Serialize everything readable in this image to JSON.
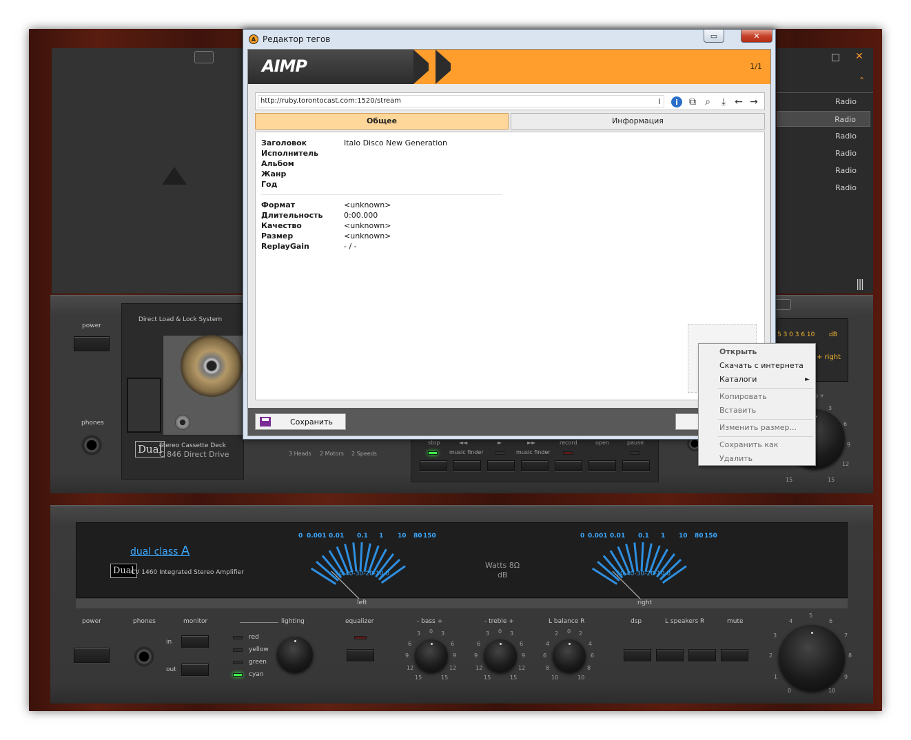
{
  "dialog": {
    "title": "Редактор тегов",
    "brand": "AIMP",
    "counter": "1/1",
    "url": "http://ruby.torontocast.com:1520/stream",
    "tabs": [
      {
        "label": "Общее"
      },
      {
        "label": "Информация"
      }
    ],
    "fields_main": [
      {
        "label": "Заголовок",
        "value": "Italo Disco New Generation"
      },
      {
        "label": "Исполнитель",
        "value": ""
      },
      {
        "label": "Альбом",
        "value": ""
      },
      {
        "label": "Жанр",
        "value": ""
      },
      {
        "label": "Год",
        "value": ""
      }
    ],
    "fields_info": [
      {
        "label": "Формат",
        "value": "<unknown>"
      },
      {
        "label": "Длительность",
        "value": "0:00.000"
      },
      {
        "label": "Качество",
        "value": "<unknown>"
      },
      {
        "label": "Размер",
        "value": "<unknown>"
      },
      {
        "label": "ReplayGain",
        "value": "- / -"
      }
    ],
    "save_label": "Сохранить"
  },
  "context_menu": {
    "items": [
      {
        "label": "Открыть",
        "state": "default"
      },
      {
        "label": "Скачать с интернета",
        "state": "enabled"
      },
      {
        "label": "Каталоги",
        "state": "submenu"
      },
      {
        "label": "Копировать",
        "state": "disabled"
      },
      {
        "label": "Вставить",
        "state": "disabled"
      },
      {
        "label": "Изменить размер...",
        "state": "disabled"
      },
      {
        "label": "Сохранить как",
        "state": "disabled"
      },
      {
        "label": "Удалить",
        "state": "disabled"
      }
    ]
  },
  "playlist": {
    "items": [
      "Radio",
      "Radio",
      "Radio",
      "Radio",
      "Radio",
      "Radio"
    ],
    "selected_index": 1
  },
  "deck": {
    "power_label": "power",
    "phones_label": "phones",
    "system_label": "Direct Load & Lock System",
    "brand": "Dual",
    "model_line1": "Stereo Cassette Deck",
    "model_line2": "C 846 Direct Drive",
    "features": [
      "3 Heads",
      "2 Motors",
      "2 Speeds"
    ],
    "transport_labels": [
      "stop",
      "◄◄",
      "►",
      "►►",
      "record",
      "open",
      "pause"
    ],
    "music_finder": "music finder",
    "vu_scale": "5 3 0 3 6 10",
    "vu_unit": "dB",
    "vu_right": "right",
    "rec_level_label": "p +",
    "level_scale": [
      "3",
      "6",
      "9",
      "12",
      "15",
      "15"
    ]
  },
  "amp": {
    "brand_line": "dual class",
    "brand_letter": "A",
    "brand": "Dual",
    "model": "CV 1460 Integrated Stereo Amplifier",
    "meter_scale": [
      "0",
      "0.001",
      "0.01",
      "0.1",
      "1",
      "10",
      "80",
      "150"
    ],
    "meter_db": "-50-40-30-20-10  0",
    "watts": "Watts 8Ω",
    "db": "dB",
    "left": "left",
    "right": "right",
    "power_label": "power",
    "phones_label": "phones",
    "monitor_label": "monitor",
    "monitor_in": "in",
    "monitor_out": "out",
    "lighting_label": "lighting",
    "lighting_options": [
      "red",
      "yellow",
      "green",
      "cyan"
    ],
    "equalizer_label": "equalizer",
    "bass_label": "-  bass  +",
    "treble_label": "-  treble  +",
    "balance_label": "L  balance  R",
    "dsp_label": "dsp",
    "speakers_label": "L  speakers  R",
    "mute_label": "mute",
    "tone_scale": [
      "3",
      "0",
      "3",
      "6",
      "6",
      "9",
      "9",
      "12",
      "12",
      "15",
      "15"
    ],
    "balance_scale": [
      "2",
      "0",
      "2",
      "4",
      "4",
      "6",
      "6",
      "8",
      "8",
      "10",
      "10"
    ],
    "volume_scale": [
      "0",
      "1",
      "2",
      "3",
      "4",
      "5",
      "6",
      "7",
      "8",
      "9",
      "10"
    ]
  }
}
